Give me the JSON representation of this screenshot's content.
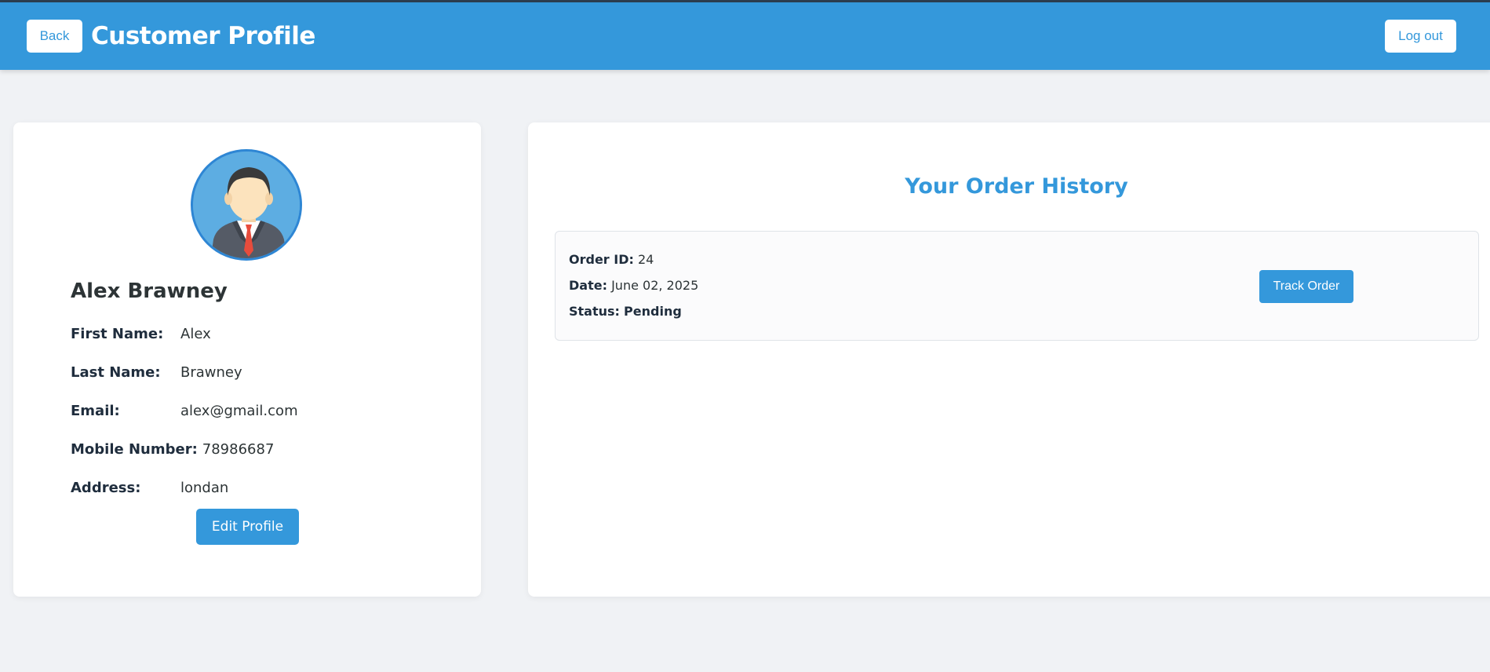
{
  "header": {
    "back_label": "Back",
    "title": "Customer Profile",
    "logout_label": "Log out"
  },
  "profile": {
    "name": "Alex Brawney",
    "avatar_icon": "person-avatar-icon",
    "fields": [
      {
        "label": "First Name:",
        "value": "Alex"
      },
      {
        "label": "Last Name:",
        "value": "Brawney"
      },
      {
        "label": "Email:",
        "value": "alex@gmail.com"
      },
      {
        "label": "Mobile Number:",
        "value": "78986687"
      },
      {
        "label": "Address:",
        "value": "londan"
      }
    ],
    "edit_label": "Edit Profile"
  },
  "orders": {
    "title": "Your Order History",
    "items": [
      {
        "id_label": "Order ID:",
        "id": "24",
        "date_label": "Date:",
        "date": "June 02, 2025",
        "status_label": "Status:",
        "status": "Pending",
        "track_label": "Track Order"
      }
    ]
  },
  "colors": {
    "primary": "#3498db",
    "background": "#f0f2f5",
    "card": "#ffffff"
  }
}
